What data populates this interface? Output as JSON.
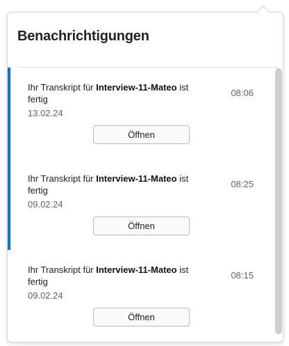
{
  "panel": {
    "title": "Benachrichtigungen"
  },
  "notifications": [
    {
      "prefix": "Ihr Transkript für ",
      "name": "Interview-11-Mateo",
      "suffix": " ist fertig",
      "date": "13.02.24",
      "time": "08:06",
      "unread": true,
      "button_label": "Öffnen"
    },
    {
      "prefix": "Ihr Transkript für ",
      "name": "Interview-11-Mateo",
      "suffix": " ist fertig",
      "date": "09.02.24",
      "time": "08:25",
      "unread": true,
      "button_label": "Öffnen"
    },
    {
      "prefix": "Ihr Transkript für ",
      "name": "Interview-11-Mateo",
      "suffix": " ist fertig",
      "date": "09.02.24",
      "time": "08:15",
      "unread": false,
      "button_label": "Öffnen"
    }
  ],
  "colors": {
    "unread_accent": "#1673c8",
    "title": "#1f2328",
    "meta_text": "#5a6572"
  }
}
